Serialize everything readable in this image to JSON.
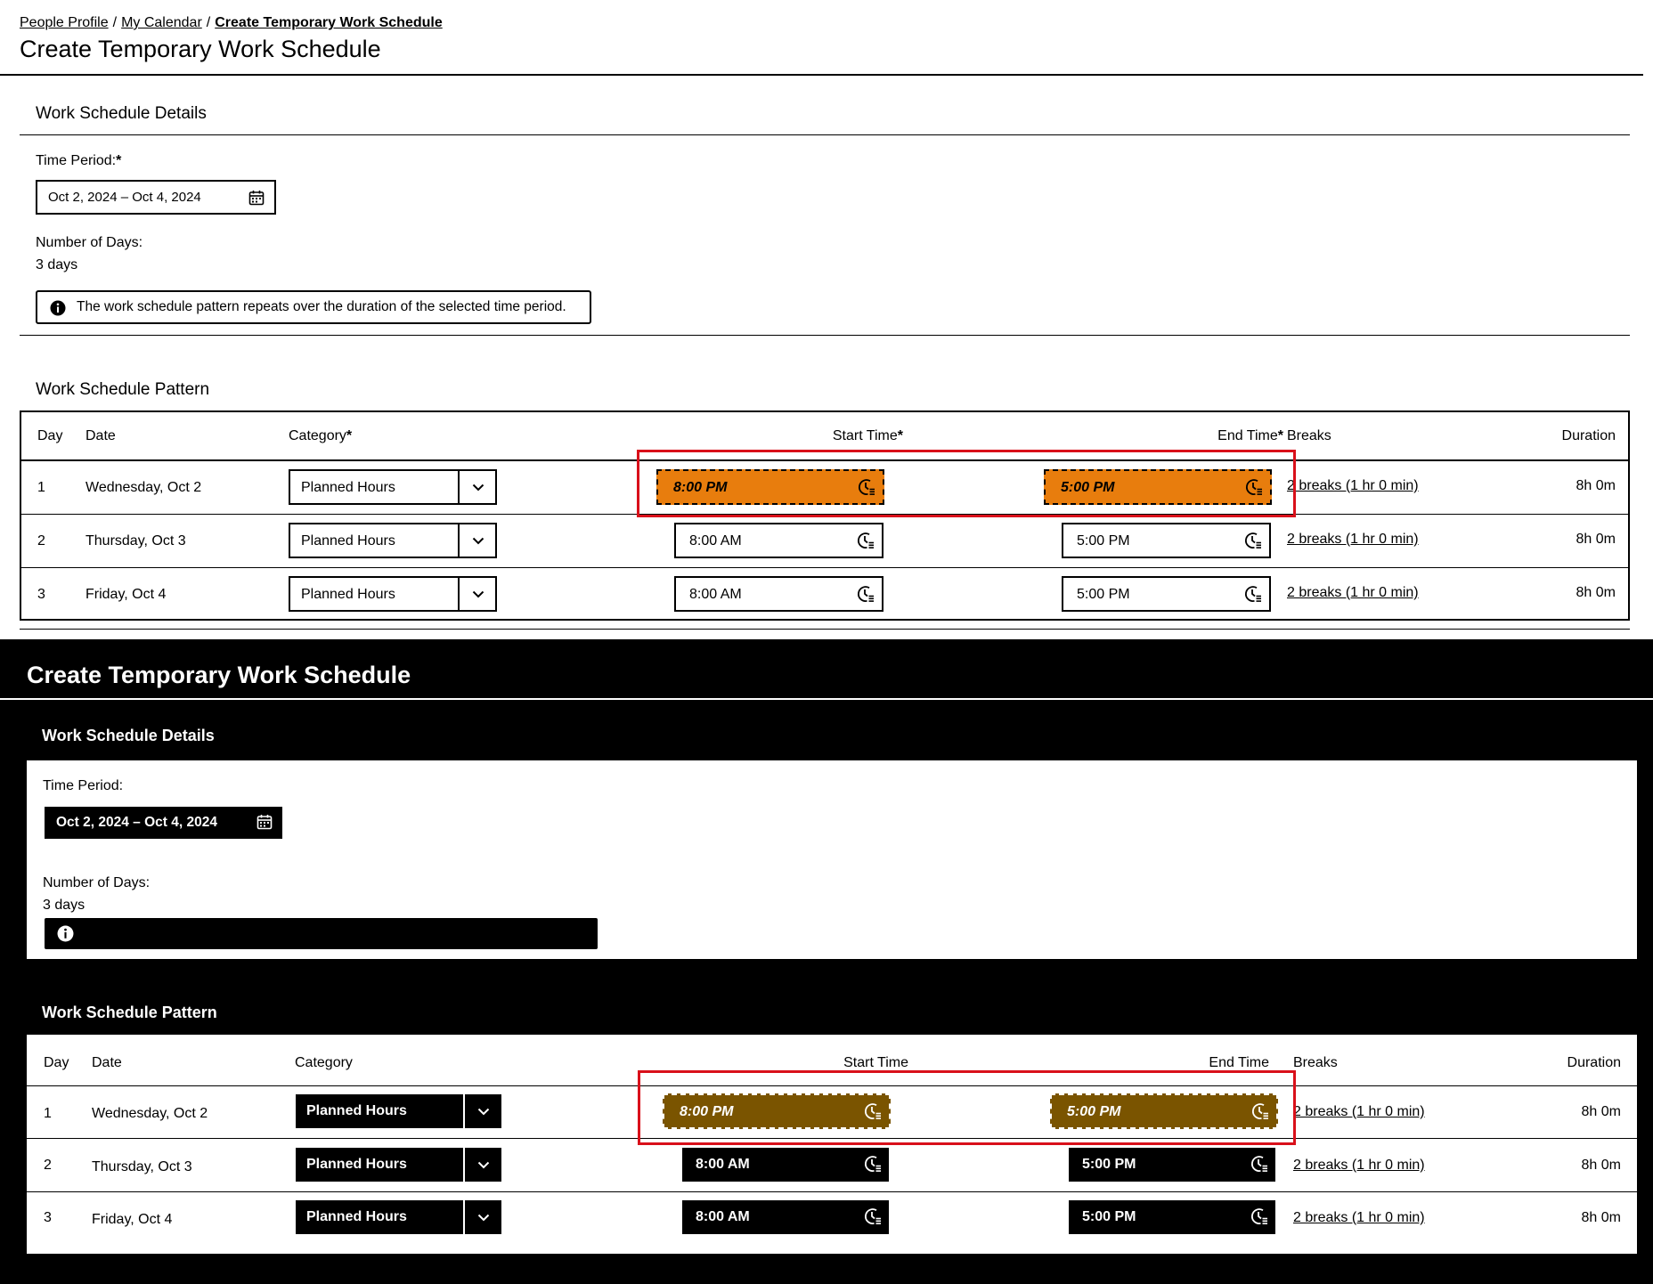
{
  "breadcrumb": {
    "items": [
      "People Profile",
      "My Calendar"
    ],
    "current": "Create Temporary Work Schedule",
    "separator": "/"
  },
  "page_title": "Create Temporary Work Schedule",
  "details": {
    "title": "Work Schedule Details",
    "time_period_label": "Time Period:",
    "required_marker": "*",
    "time_period_value": "Oct 2, 2024 – Oct 4, 2024",
    "days_label": "Number of Days:",
    "days_value": "3 days",
    "info_text": "The work schedule pattern repeats over the duration of the selected time period."
  },
  "pattern": {
    "title": "Work Schedule Pattern",
    "headers": {
      "day": "Day",
      "date": "Date",
      "category": "Category",
      "start_time": "Start Time",
      "end_time": "End Time",
      "breaks": "Breaks",
      "duration": "Duration"
    },
    "rows": [
      {
        "day": "1",
        "date": "Wednesday, Oct 2",
        "category": "Planned Hours",
        "start": "8:00 PM",
        "end": "5:00 PM",
        "breaks": "2 breaks (1 hr 0 min)",
        "duration": "8h 0m"
      },
      {
        "day": "2",
        "date": "Thursday, Oct 3",
        "category": "Planned Hours",
        "start": "8:00 AM",
        "end": "5:00 PM",
        "breaks": "2 breaks (1 hr 0 min)",
        "duration": "8h 0m"
      },
      {
        "day": "3",
        "date": "Friday, Oct 4",
        "category": "Planned Hours",
        "start": "8:00 AM",
        "end": "5:00 PM",
        "breaks": "2 breaks (1 hr 0 min)",
        "duration": "8h 0m"
      }
    ]
  },
  "colors": {
    "error_highlight_light": "#e87d0d",
    "error_highlight_dark": "#7a5400",
    "annotation_box": "#d9101a"
  },
  "icons": [
    "calendar-icon",
    "info-icon",
    "chevron-down-icon",
    "clock-icon"
  ]
}
